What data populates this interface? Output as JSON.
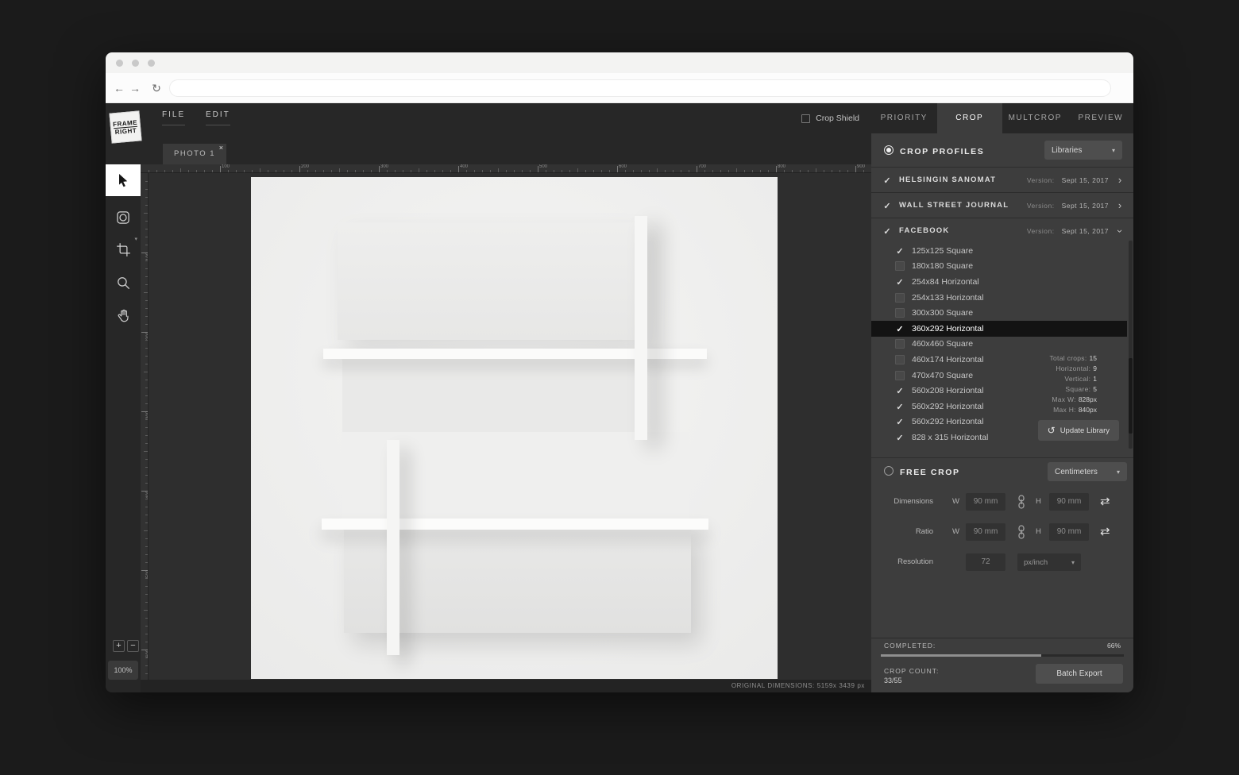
{
  "browser": {
    "url": "",
    "back_icon": "←",
    "forward_icon": "→",
    "reload_icon": "↻"
  },
  "glyphs": {
    "check": "✓",
    "chevron": "›",
    "caret": "▾",
    "close": "×",
    "swap": "⇄",
    "refresh": "↺"
  },
  "app": {
    "logo_line1": "FRAME",
    "logo_line2": "RIGHT",
    "menu": {
      "file": "FILE",
      "edit": "EDIT"
    },
    "crop_shield_label": "Crop Shield",
    "tabs": [
      {
        "label": "PRIORITY",
        "active": false
      },
      {
        "label": "CROP",
        "active": true
      },
      {
        "label": "MULTCROP",
        "active": false
      },
      {
        "label": "PREVIEW",
        "active": false
      }
    ],
    "photo_tab": {
      "label": "PHOTO 1"
    },
    "zoom": {
      "plus": "+",
      "minus": "−",
      "level": "100%"
    },
    "status": "ORIGINAL DIMENSIONS: 5159x 3439 px",
    "ruler": {
      "minor_step": 10,
      "label_step": 100,
      "top_length": 918,
      "top_label_max": 900,
      "left_length": 636,
      "left_label_max": 600
    }
  },
  "crop_profiles": {
    "title": "CROP PROFILES",
    "library_dropdown": "Libraries",
    "version_label": "Version:",
    "libraries": [
      {
        "name": "HELSINGIN SANOMAT",
        "version": "Sept 15, 2017",
        "checked": true,
        "expanded": false
      },
      {
        "name": "WALL STREET JOURNAL",
        "version": "Sept 15, 2017",
        "checked": true,
        "expanded": false
      },
      {
        "name": "FACEBOOK",
        "version": "Sept 15, 2017",
        "checked": true,
        "expanded": true
      }
    ],
    "facebook_items": [
      {
        "label": "125x125 Square",
        "checked": true,
        "selected": false
      },
      {
        "label": "180x180 Square",
        "checked": false,
        "selected": false
      },
      {
        "label": "254x84 Horizontal",
        "checked": true,
        "selected": false
      },
      {
        "label": "254x133 Horizontal",
        "checked": false,
        "selected": false
      },
      {
        "label": "300x300 Square",
        "checked": false,
        "selected": false
      },
      {
        "label": "360x292 Horizontal",
        "checked": true,
        "selected": true
      },
      {
        "label": "460x460 Square",
        "checked": false,
        "selected": false
      },
      {
        "label": "460x174 Horizontal",
        "checked": false,
        "selected": false
      },
      {
        "label": "470x470 Square",
        "checked": false,
        "selected": false
      },
      {
        "label": "560x208 Horziontal",
        "checked": true,
        "selected": false
      },
      {
        "label": "560x292 Horizontal",
        "checked": true,
        "selected": false
      },
      {
        "label": "560x292 Horizontal",
        "checked": true,
        "selected": false
      },
      {
        "label": "828 x 315 Horizontal",
        "checked": true,
        "selected": false
      }
    ],
    "stats": [
      {
        "label": "Total crops:",
        "value": "15"
      },
      {
        "label": "Horizontal:",
        "value": "9"
      },
      {
        "label": "Vertical:",
        "value": "1"
      },
      {
        "label": "Square:",
        "value": "5"
      },
      {
        "label": "Max W:",
        "value": "828px"
      },
      {
        "label": "Max H:",
        "value": "840px"
      }
    ],
    "update_library_label": "Update Library"
  },
  "free_crop": {
    "title": "FREE CROP",
    "units_dropdown": "Centimeters",
    "dimensions_label": "Dimensions",
    "ratio_label": "Ratio",
    "resolution_label": "Resolution",
    "w_label": "W",
    "h_label": "H",
    "dim_w": "90 mm",
    "dim_h": "90 mm",
    "ratio_w": "90 mm",
    "ratio_h": "90 mm",
    "resolution_value": "72",
    "resolution_unit": "px/inch"
  },
  "footer": {
    "completed_label": "COMPLETED:",
    "completed_value": "66%",
    "progress_pct": 66,
    "crop_count_label": "CROP COUNT:",
    "crop_count_value": "33/55",
    "batch_export_label": "Batch Export"
  }
}
